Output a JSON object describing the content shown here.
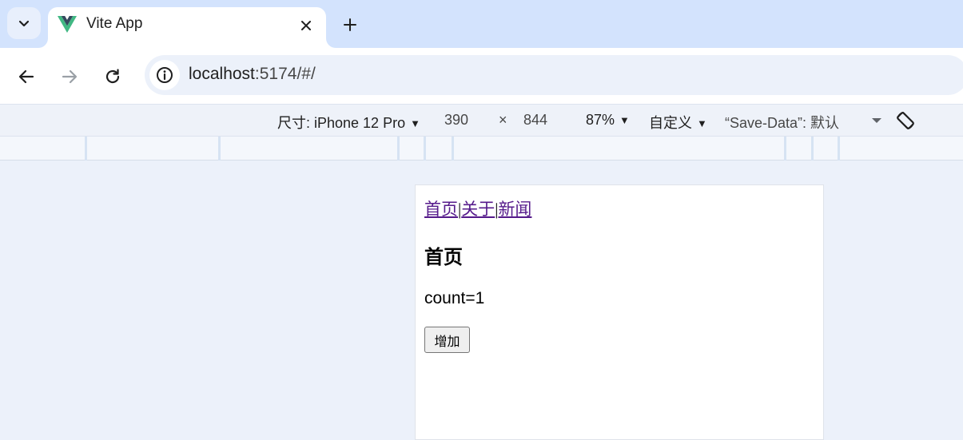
{
  "browser": {
    "tab": {
      "title": "Vite App",
      "favicon": "vue-logo-icon"
    },
    "address": {
      "host": "localhost",
      "path": ":5174/#/"
    },
    "colors": {
      "tabstrip": "#d3e3fd",
      "toolbar": "#ffffff",
      "omnibox": "#ecf1fa"
    }
  },
  "device_toolbar": {
    "dimensions_label": "尺寸: iPhone 12 Pro",
    "width": "390",
    "times": "×",
    "height": "844",
    "zoom": "87%",
    "throttle": "自定义",
    "save_data": "“Save-Data”:  默认"
  },
  "app": {
    "nav": {
      "home": "首页",
      "about": "关于",
      "news": "新闻",
      "separator": "|"
    },
    "heading": "首页",
    "count_text": "count=1",
    "increment_label": "增加",
    "colors": {
      "visited_link": "#551a8b"
    }
  }
}
